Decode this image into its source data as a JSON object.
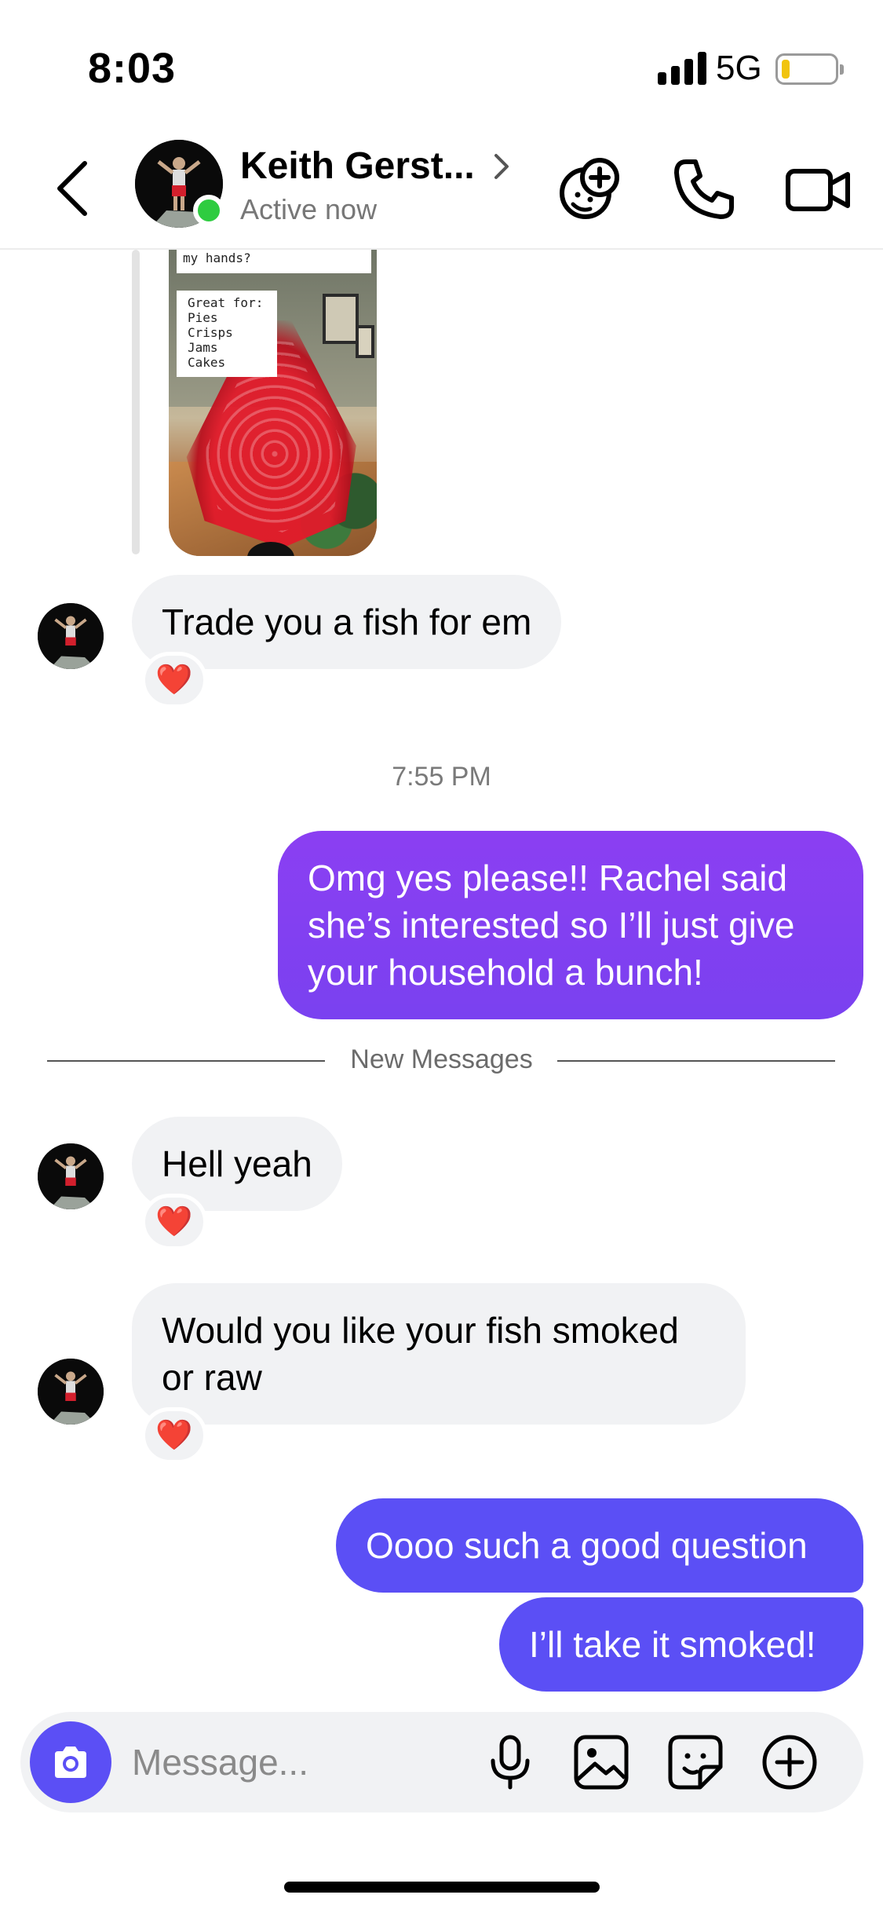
{
  "status_bar": {
    "time": "8:03",
    "network": "5G",
    "battery_level": 0.1,
    "battery_color": "#f1c40f"
  },
  "header": {
    "contact_name": "Keith Gerst...",
    "status": "Active now",
    "icons": [
      "back-icon",
      "avatar",
      "effects-icon",
      "phone-icon",
      "video-icon"
    ]
  },
  "story_reply": {
    "caption_top": "my hands?",
    "caption_heading": "Great for:",
    "caption_items": [
      "Pies",
      "Crisps",
      "Jams",
      "Cakes"
    ]
  },
  "messages": {
    "m1": {
      "text": "Trade you a fish for em",
      "reaction": "❤️"
    },
    "timestamp": "7:55 PM",
    "m2": {
      "lines": [
        "Omg yes please!! Rachel said",
        "she’s interested so I’ll just give",
        "your household a bunch!"
      ]
    },
    "new_messages_label": "New Messages",
    "m3": {
      "text": "Hell yeah",
      "reaction": "❤️"
    },
    "m4": {
      "lines": [
        "Would you like your fish smoked",
        "or raw"
      ],
      "reaction": "❤️"
    },
    "m5": {
      "text": "Oooo such a good question"
    },
    "m6": {
      "text": "I’ll take it smoked!"
    }
  },
  "composer": {
    "placeholder": "Message..."
  },
  "colors": {
    "outgoing_purple": "#8a3ff0",
    "outgoing_indigo": "#5b4ff5",
    "incoming_bubble": "#f1f2f4",
    "online_green": "#2ecc40"
  }
}
